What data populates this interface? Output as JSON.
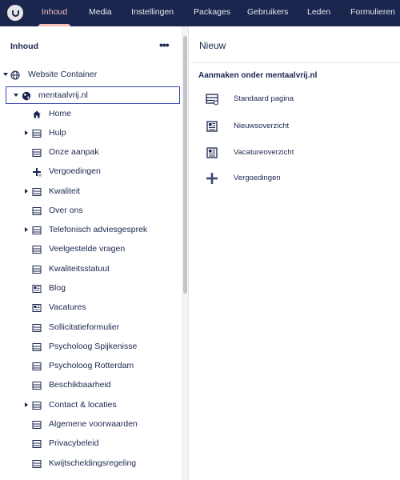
{
  "nav": {
    "tabs": [
      {
        "label": "Inhoud",
        "active": true
      },
      {
        "label": "Media"
      },
      {
        "label": "Instellingen"
      },
      {
        "label": "Packages"
      },
      {
        "label": "Gebruikers"
      },
      {
        "label": "Leden"
      },
      {
        "label": "Formulieren"
      }
    ]
  },
  "tree": {
    "title": "Inhoud",
    "menu_glyph": "•••",
    "items": [
      {
        "label": "Website Container",
        "icon": "globe-icon"
      },
      {
        "label": "mentaalvrij.nl",
        "icon": "globe-icon"
      },
      {
        "label": "Home",
        "icon": "home-icon"
      },
      {
        "label": "Hulp",
        "icon": "page-icon"
      },
      {
        "label": "Onze aanpak",
        "icon": "page-icon"
      },
      {
        "label": "Vergoedingen",
        "icon": "plus-icon"
      },
      {
        "label": "Kwaliteit",
        "icon": "page-icon"
      },
      {
        "label": "Over ons",
        "icon": "page-icon"
      },
      {
        "label": "Telefonisch adviesgesprek",
        "icon": "page-icon"
      },
      {
        "label": "Veelgestelde vragen",
        "icon": "page-icon"
      },
      {
        "label": "Kwaliteitsstatuut",
        "icon": "page-icon"
      },
      {
        "label": "Blog",
        "icon": "overview-icon"
      },
      {
        "label": "Vacatures",
        "icon": "overview-icon"
      },
      {
        "label": "Sollicitatieformulier",
        "icon": "page-icon"
      },
      {
        "label": "Psycholoog Spijkenisse",
        "icon": "page-icon"
      },
      {
        "label": "Psycholoog Rotterdam",
        "icon": "page-icon"
      },
      {
        "label": "Beschikbaarheid",
        "icon": "page-icon"
      },
      {
        "label": "Contact & locaties",
        "icon": "page-icon"
      },
      {
        "label": "Algemene voorwaarden",
        "icon": "page-icon"
      },
      {
        "label": "Privacybeleid",
        "icon": "page-icon"
      },
      {
        "label": "Kwijtscheldingsregeling",
        "icon": "page-icon"
      }
    ]
  },
  "content": {
    "title": "Nieuw",
    "section_title": "Aanmaken onder mentaalvrij.nl",
    "options": [
      {
        "label": "Standaard pagina",
        "icon": "page-icon"
      },
      {
        "label": "Nieuwsoverzicht",
        "icon": "news-icon"
      },
      {
        "label": "Vacatureoverzicht",
        "icon": "news-icon"
      },
      {
        "label": "Vergoedingen",
        "icon": "plus-icon"
      }
    ]
  },
  "colors": {
    "topbar": "#1b264f",
    "active_tab": "#f5c1bc",
    "selection_border": "#3544b1",
    "text": "#1b264f"
  }
}
